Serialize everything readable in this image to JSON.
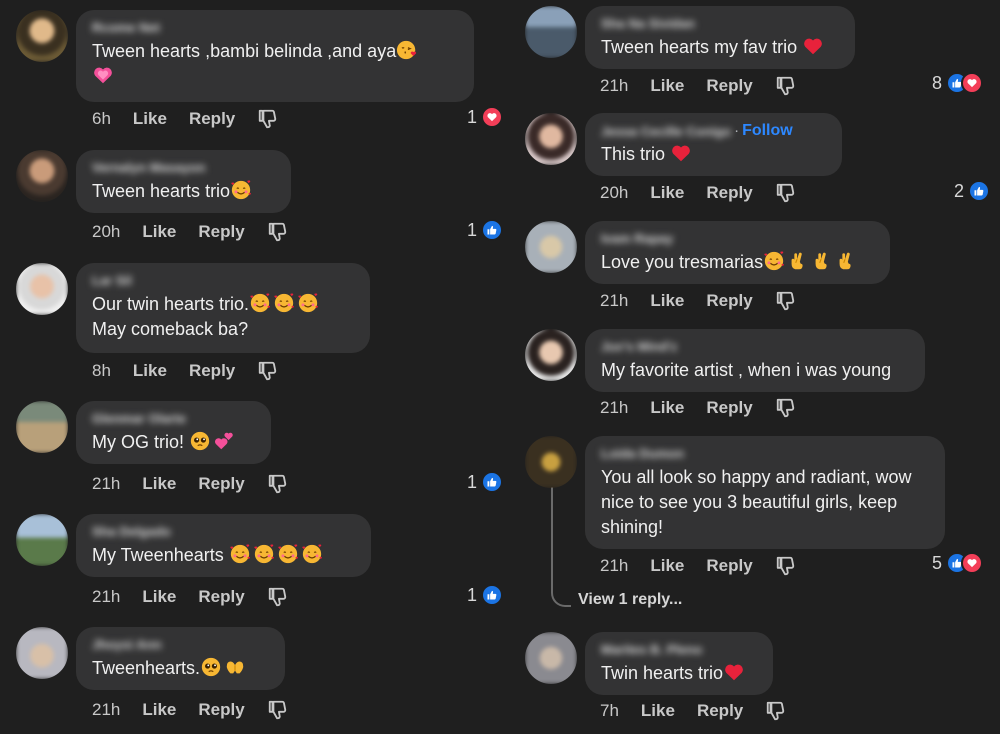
{
  "labels": {
    "like": "Like",
    "reply": "Reply"
  },
  "colors": {
    "background": "#1f1f1f",
    "bubble": "#333334",
    "link_blue": "#2d88ff",
    "like_blue": "#1b74e4",
    "love_red": "#f33e58"
  },
  "left_comments": [
    {
      "author": "Rcome Net",
      "text": "Tween hearts ,bambi belinda ,and aya",
      "emojis": [
        "kissing-heart",
        "pink-heart"
      ],
      "time": "6h",
      "reaction_count": "1",
      "reactions": [
        "love"
      ]
    },
    {
      "author": "Vernalyn Masayon",
      "text": "Tween hearts trio",
      "emojis": [
        "smiling-hearts"
      ],
      "time": "20h",
      "reaction_count": "1",
      "reactions": [
        "like"
      ]
    },
    {
      "author": "Lar Sil",
      "text": "Our twin hearts trio.",
      "text_line2": "May comeback ba?",
      "emojis": [
        "smiling-hearts",
        "smiling-hearts",
        "smiling-hearts"
      ],
      "time": "8h",
      "reaction_count": "",
      "reactions": []
    },
    {
      "author": "Glenmar Olarte",
      "text": "My OG trio! ",
      "emojis": [
        "pleading-face",
        "two-hearts"
      ],
      "time": "21h",
      "reaction_count": "1",
      "reactions": [
        "like"
      ]
    },
    {
      "author": "Sha Delgado",
      "text": "My Tweenhearts ",
      "emojis": [
        "smiling-hearts",
        "smiling-hearts",
        "smiling-hearts",
        "smiling-hearts"
      ],
      "time": "21h",
      "reaction_count": "1",
      "reactions": [
        "like"
      ]
    },
    {
      "author": "Jhoysi Ann",
      "text": "Tweenhearts.",
      "emojis": [
        "pleading-face",
        "heart-hands"
      ],
      "time": "21h",
      "reaction_count": "",
      "reactions": []
    }
  ],
  "right_comments": [
    {
      "author": "Sha Na Sividan",
      "text": "Tween hearts my fav trio ",
      "emojis": [
        "red-heart"
      ],
      "time": "21h",
      "reaction_count": "8",
      "reactions": [
        "like",
        "love"
      ]
    },
    {
      "author": "Jessa Cecille Conigo",
      "follow": "Follow",
      "text": "This trio ",
      "emojis": [
        "red-heart"
      ],
      "time": "20h",
      "reaction_count": "2",
      "reactions": [
        "like"
      ]
    },
    {
      "author": "Ivam Rapay",
      "text": "Love you tresmarias",
      "emojis": [
        "smiling-hearts",
        "crossed-fingers",
        "crossed-fingers",
        "crossed-fingers"
      ],
      "time": "21h",
      "reaction_count": "",
      "reactions": []
    },
    {
      "author": "Juv's Mind'z",
      "text": "My favorite artist , when i was young",
      "emojis": [],
      "time": "21h",
      "reaction_count": "",
      "reactions": []
    },
    {
      "author": "Loida Dumon",
      "text": "You all look so happy and radiant, wow",
      "text_line2": "nice to see you 3 beautiful girls, keep",
      "text_line3": "shining!",
      "emojis": [],
      "time": "21h",
      "reaction_count": "5",
      "reactions": [
        "like",
        "love"
      ]
    },
    {
      "author": "Marites B. Pleno",
      "text": "Twin hearts trio",
      "emojis": [
        "red-heart"
      ],
      "time": "7h",
      "reaction_count": "",
      "reactions": []
    }
  ],
  "view_replies": "View 1 reply..."
}
